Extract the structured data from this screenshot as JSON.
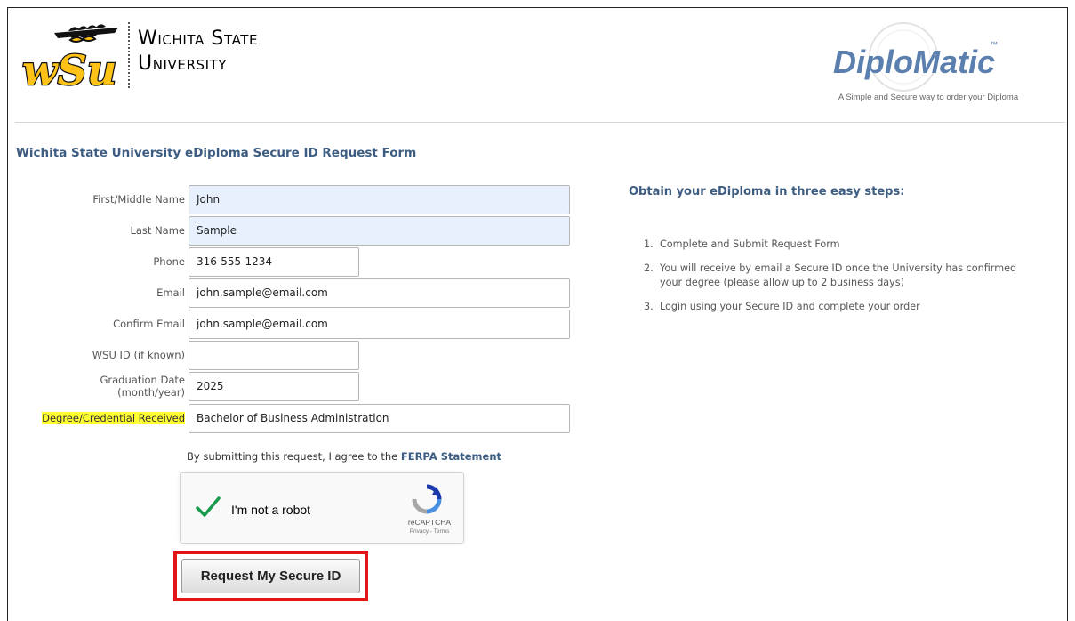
{
  "header": {
    "university_name_line1": "Wichita State",
    "university_name_line2": "University",
    "wsu_logo_text": "wSu",
    "diplomatic_logo_text": "DiploMatic",
    "diplomatic_tagline": "A Simple and Secure way to order your Diploma"
  },
  "form": {
    "title": "Wichita State University eDiploma Secure ID Request Form",
    "fields": {
      "first_name": {
        "label": "First/Middle Name",
        "value": "John"
      },
      "last_name": {
        "label": "Last Name",
        "value": "Sample"
      },
      "phone": {
        "label": "Phone",
        "value": "316-555-1234"
      },
      "email": {
        "label": "Email",
        "value": "john.sample@email.com"
      },
      "confirm_email": {
        "label": "Confirm Email",
        "value": "john.sample@email.com"
      },
      "wsu_id": {
        "label": "WSU ID (if known)",
        "value": ""
      },
      "graduation_date": {
        "label_line1": "Graduation Date",
        "label_line2": "(month/year)",
        "value": "2025"
      },
      "degree": {
        "label": "Degree/Credential Received",
        "value": "Bachelor of Business Administration"
      }
    },
    "agreement_text": "By submitting this request, I agree to the",
    "agreement_link": "FERPA Statement",
    "captcha": {
      "label": "I'm not a robot",
      "brand": "reCAPTCHA",
      "links": "Privacy - Terms",
      "checked": true
    },
    "submit_label": "Request My Secure ID"
  },
  "steps": {
    "title": "Obtain your eDiploma in three easy steps:",
    "items": [
      {
        "num": "1.",
        "text": "Complete and Submit Request Form"
      },
      {
        "num": "2.",
        "text": "You will receive by email a Secure ID once the University has confirmed your degree (please allow up to 2 business days)"
      },
      {
        "num": "3.",
        "text": "Login using your Secure ID and complete your order"
      }
    ]
  },
  "colors": {
    "heading_blue": "#3d5c82",
    "autofill_bg": "#e8f0fe",
    "label_highlight": "#ffff33",
    "submit_outline": "#e2151b",
    "wsu_gold": "#ffc217"
  }
}
